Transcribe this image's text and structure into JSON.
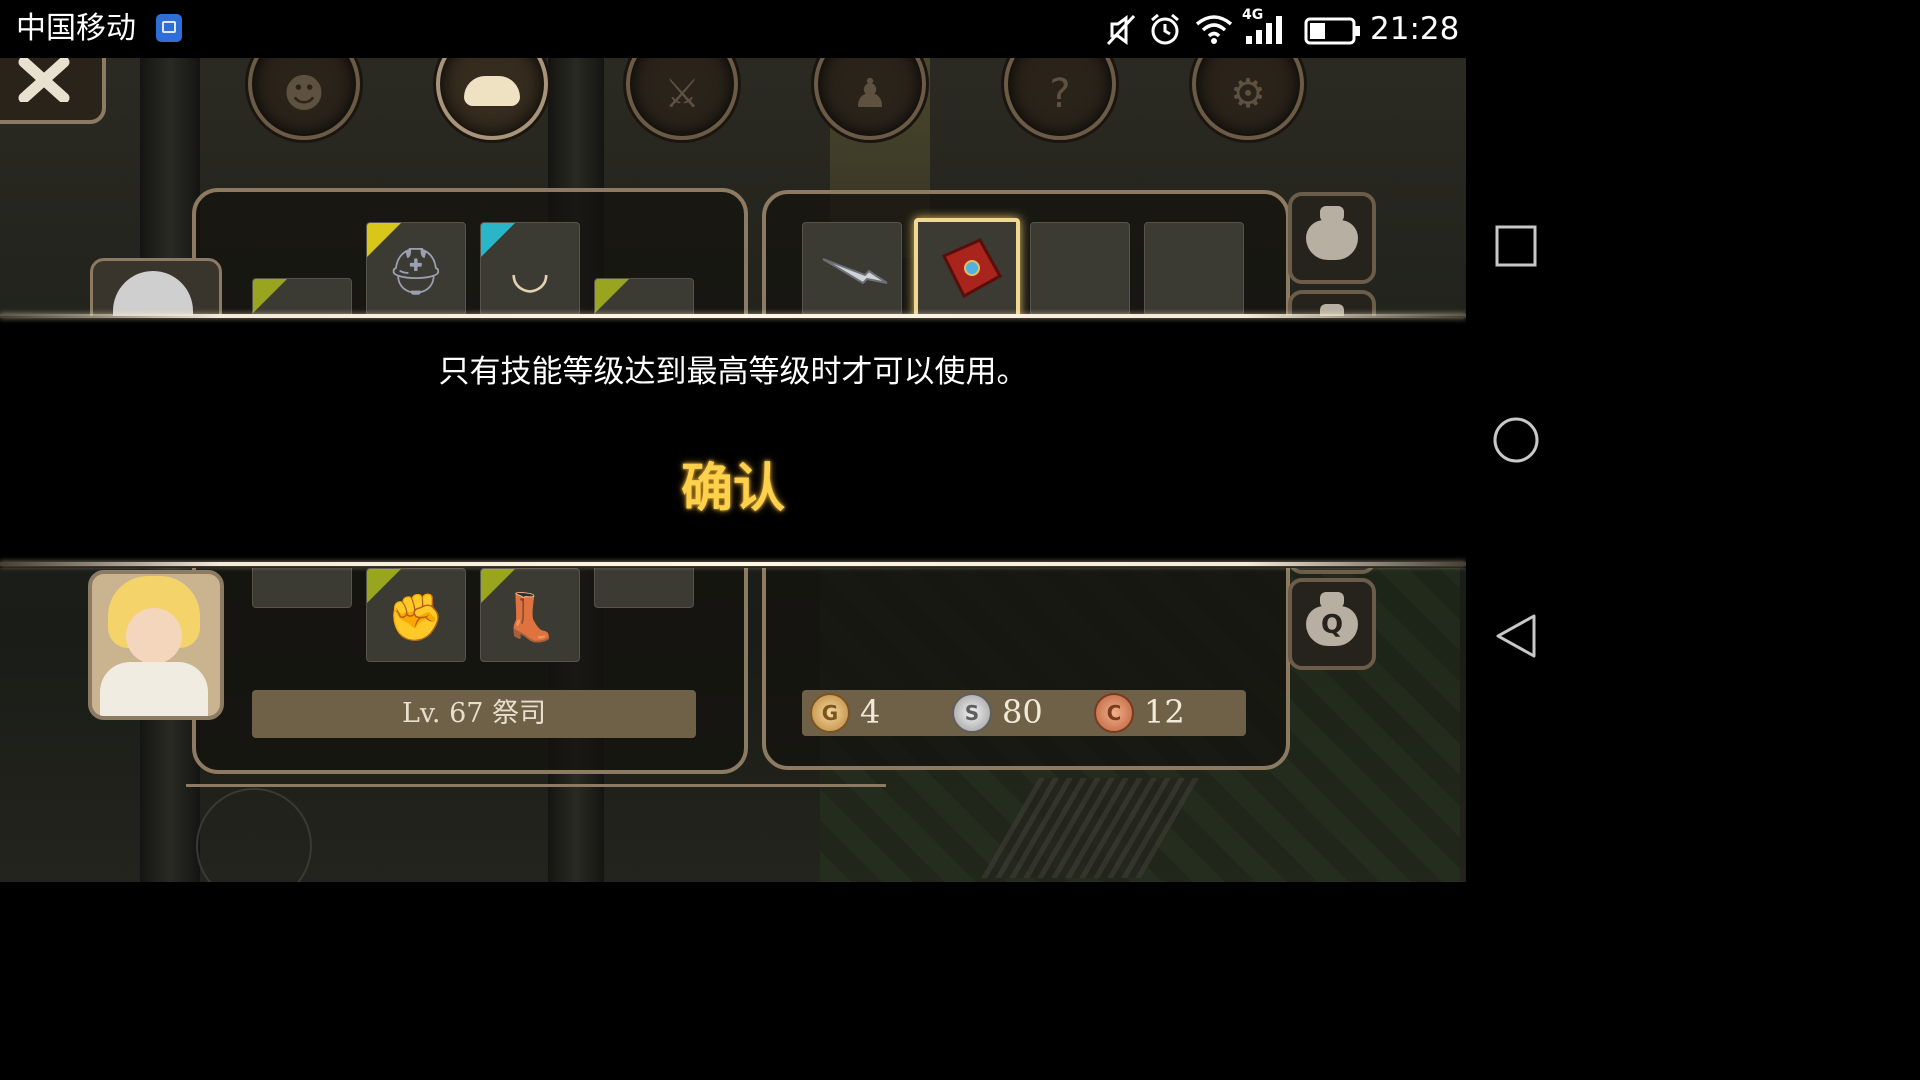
{
  "status_bar": {
    "carrier": "中国移动",
    "network": "4G",
    "time": "21:28",
    "icons": [
      "gallery-icon",
      "mute-icon",
      "alarm-icon",
      "wifi-icon",
      "signal-icon",
      "battery-icon"
    ],
    "battery_level": 0.35
  },
  "top_menu": {
    "close_icon": "close-icon",
    "tabs": [
      "head-icon",
      "bag-icon",
      "skills-icon",
      "party-icon",
      "quest-scroll-icon",
      "settings-gear-icon"
    ],
    "active_tab_index": 1
  },
  "character": {
    "level_label": "Lv. 67 祭司",
    "equipment_slots": [
      "helmet",
      "necklace",
      "gloves",
      "boots"
    ]
  },
  "inventory": {
    "items": [
      "dagger",
      "red-spellbook",
      "",
      ""
    ],
    "selected_index": 1
  },
  "currency": {
    "gold_symbol": "G",
    "gold": "4",
    "silver_symbol": "S",
    "silver": "80",
    "copper_symbol": "C",
    "copper": "12"
  },
  "side_buttons": {
    "quest_bag_letter": "Q"
  },
  "dialog": {
    "message": "只有技能等级达到最高等级时才可以使用。",
    "confirm_label": "确认"
  },
  "colors": {
    "confirm_text": "#ffd04a",
    "panel_border": "#8c7a62",
    "dialog_bg": "#000000"
  }
}
